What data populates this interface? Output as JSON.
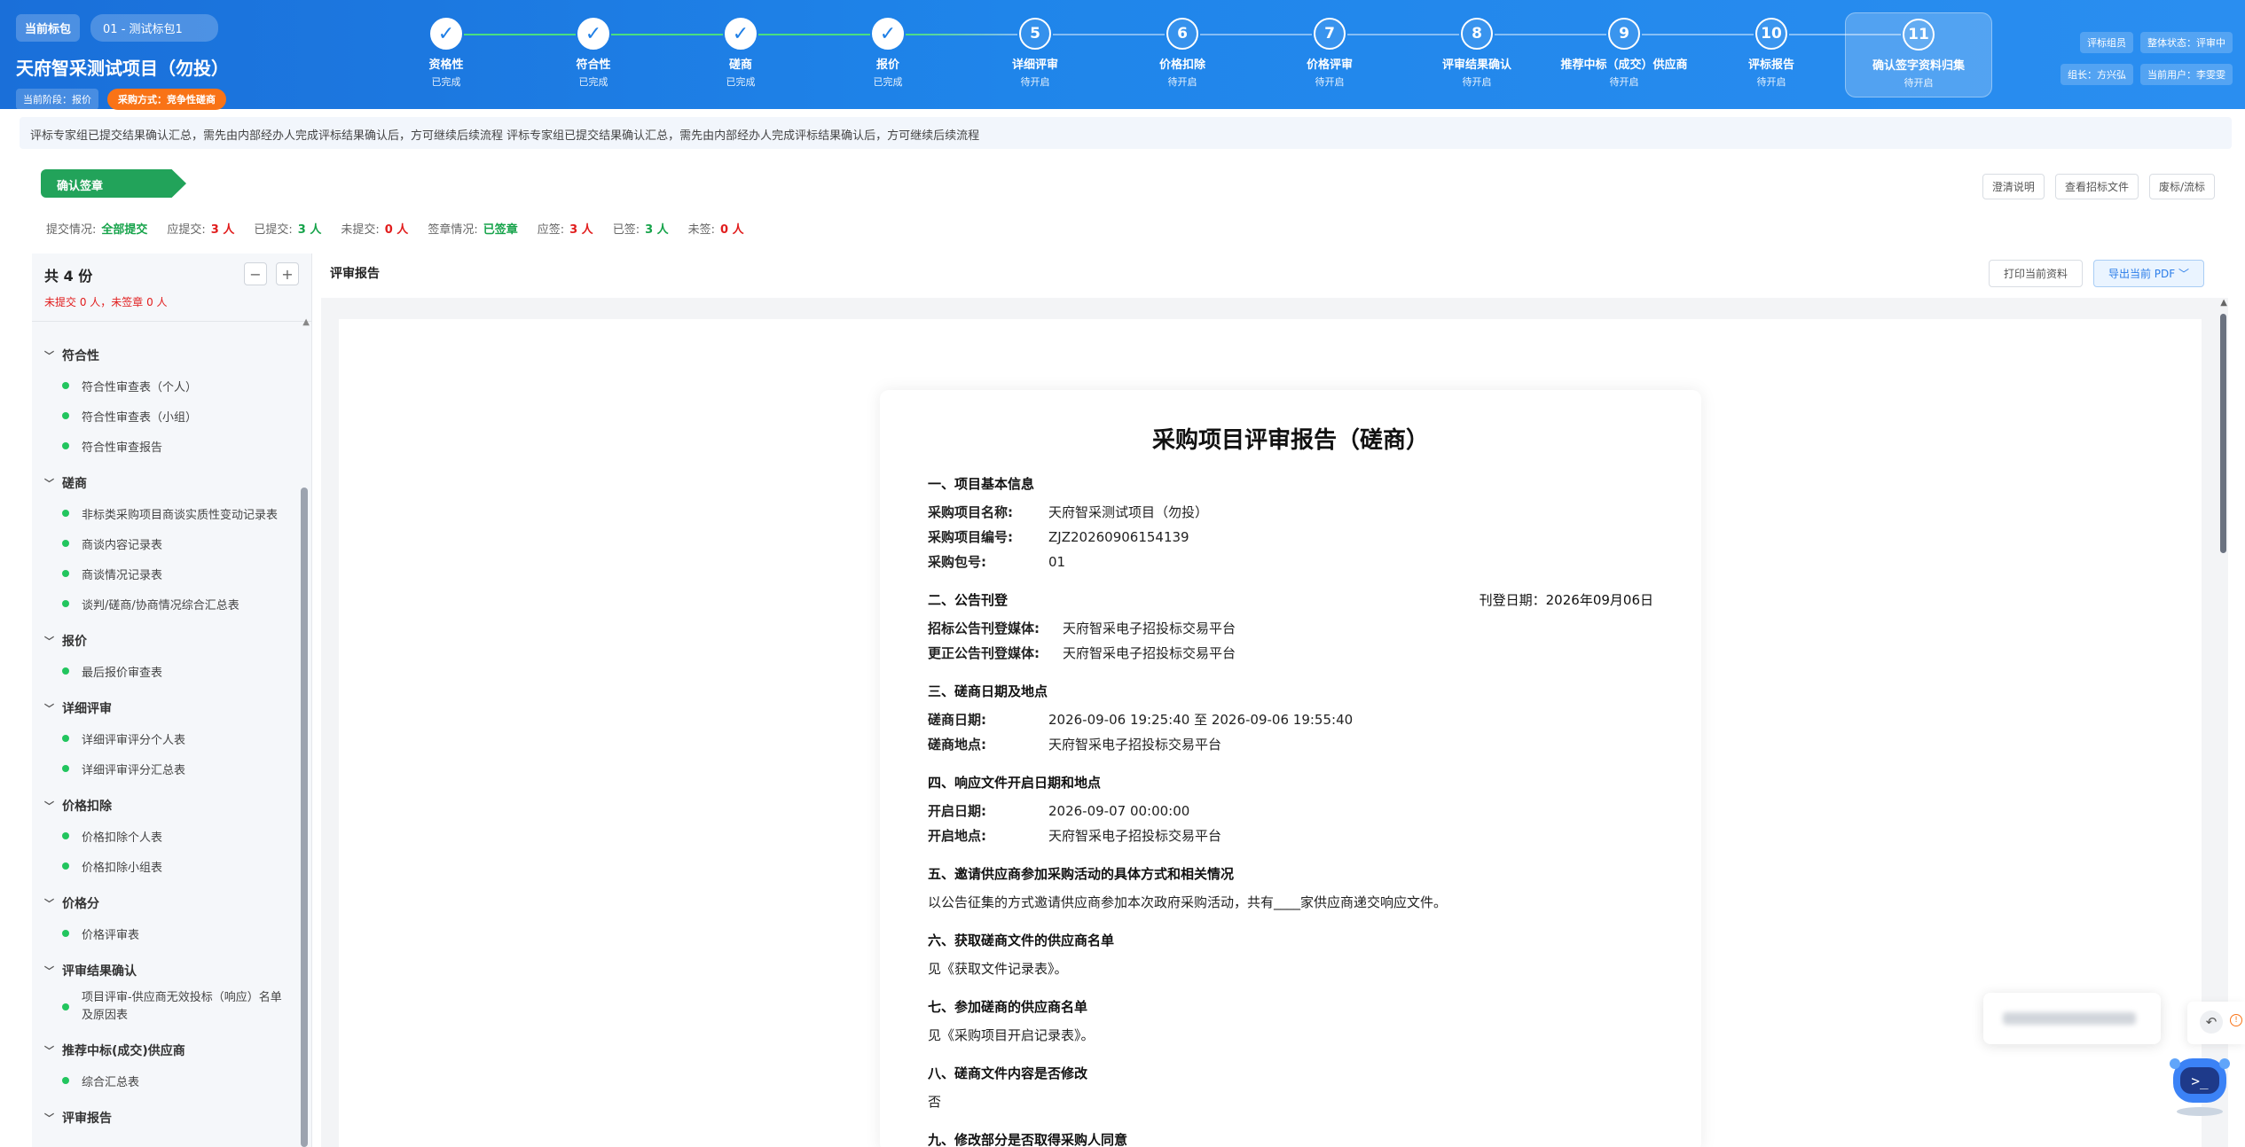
{
  "header": {
    "current_package_label": "当前标包",
    "current_package_value": "01 - 测试标包1",
    "project_title": "天府智采测试项目（勿投）",
    "stage_label": "当前阶段：报价",
    "method_label": "采购方式：竞争性磋商",
    "steps": [
      {
        "num": "1",
        "name": "资格性",
        "status": "已完成",
        "done": true
      },
      {
        "num": "2",
        "name": "符合性",
        "status": "已完成",
        "done": true
      },
      {
        "num": "3",
        "name": "磋商",
        "status": "已完成",
        "done": true
      },
      {
        "num": "4",
        "name": "报价",
        "status": "已完成",
        "done": true
      },
      {
        "num": "5",
        "name": "详细评审",
        "status": "待开启",
        "done": false
      },
      {
        "num": "6",
        "name": "价格扣除",
        "status": "待开启",
        "done": false
      },
      {
        "num": "7",
        "name": "价格评审",
        "status": "待开启",
        "done": false
      },
      {
        "num": "8",
        "name": "评审结果确认",
        "status": "待开启",
        "done": false
      },
      {
        "num": "9",
        "name": "推荐中标（成交）供应商",
        "status": "待开启",
        "done": false
      },
      {
        "num": "10",
        "name": "评标报告",
        "status": "待开启",
        "done": false
      },
      {
        "num": "11",
        "name": "确认签字资料归集",
        "status": "待开启",
        "done": false,
        "active": true
      }
    ],
    "right": {
      "role": "评标组员",
      "overall_status": "整体状态：评审中",
      "leader": "组长：方兴弘",
      "current_user": "当前用户：李雯雯"
    }
  },
  "notice": "评标专家组已提交结果确认汇总，需先由内部经办人完成评标结果确认后，方可继续后续流程 评标专家组已提交结果确认汇总，需先由内部经办人完成评标结果确认后，方可继续后续流程",
  "section": {
    "ribbon": "确认签章",
    "actions": [
      "澄清说明",
      "查看招标文件",
      "废标/流标"
    ]
  },
  "stats": {
    "submit_label": "提交情况:",
    "submit_value": "全部提交",
    "should_submit_label": "应提交:",
    "should_submit_value": "3 人",
    "submitted_label": "已提交:",
    "submitted_value": "3 人",
    "not_submitted_label": "未提交:",
    "not_submitted_value": "0 人",
    "sign_label": "签章情况:",
    "sign_value": "已签章",
    "should_sign_label": "应签:",
    "should_sign_value": "3 人",
    "signed_label": "已签:",
    "signed_value": "3 人",
    "unsigned_label": "未签:",
    "unsigned_value": "0 人"
  },
  "left_panel": {
    "count": "共 4 份",
    "sub": "未提交 0 人，未签章 0 人",
    "minus": "−",
    "plus": "+",
    "groups": [
      {
        "name": "符合性",
        "items": [
          "符合性审查表（个人）",
          "符合性审查表（小组）",
          "符合性审查报告"
        ]
      },
      {
        "name": "磋商",
        "items": [
          "非标类采购项目商谈实质性变动记录表",
          "商谈内容记录表",
          "商谈情况记录表",
          "谈判/磋商/协商情况综合汇总表"
        ]
      },
      {
        "name": "报价",
        "items": [
          "最后报价审查表"
        ]
      },
      {
        "name": "详细评审",
        "items": [
          "详细评审评分个人表",
          "详细评审评分汇总表"
        ]
      },
      {
        "name": "价格扣除",
        "items": [
          "价格扣除个人表",
          "价格扣除小组表"
        ]
      },
      {
        "name": "价格分",
        "items": [
          "价格评审表"
        ]
      },
      {
        "name": "评审结果确认",
        "items": [
          "项目评审-供应商无效投标（响应）名单及原因表"
        ]
      },
      {
        "name": "推荐中标(成交)供应商",
        "items": [
          "综合汇总表"
        ]
      },
      {
        "name": "评审报告",
        "items": []
      }
    ]
  },
  "right_panel": {
    "title": "评审报告",
    "print_label": "打印当前资料",
    "export_label": "导出当前 PDF ﹀"
  },
  "document": {
    "title": "采购项目评审报告（磋商）",
    "s1": "一、项目基本信息",
    "project_name_k": "采购项目名称:",
    "project_name_v": "天府智采测试项目（勿投）",
    "project_no_k": "采购项目编号:",
    "project_no_v": "ZJZ20260906154139",
    "package_k": "采购包号:",
    "package_v": "01",
    "s2": "二、公告刊登",
    "publish_date": "刊登日期：2026年09月06日",
    "media_k": "招标公告刊登媒体:",
    "media_v": "天府智采电子招投标交易平台",
    "correction_k": "更正公告刊登媒体:",
    "correction_v": "天府智采电子招投标交易平台",
    "s3": "三、磋商日期及地点",
    "nego_date_k": "磋商日期:",
    "nego_date_v": "2026-09-06 19:25:40 至 2026-09-06 19:55:40",
    "nego_place_k": "磋商地点:",
    "nego_place_v": "天府智采电子招投标交易平台",
    "s4": "四、响应文件开启日期和地点",
    "open_date_k": "开启日期:",
    "open_date_v": "2026-09-07 00:00:00",
    "open_place_k": "开启地点:",
    "open_place_v": "天府智采电子招投标交易平台",
    "s5": "五、邀请供应商参加采购活动的具体方式和相关情况",
    "p5": "以公告征集的方式邀请供应商参加本次政府采购活动，共有____家供应商递交响应文件。",
    "s6": "六、获取磋商文件的供应商名单",
    "p6": "见《获取文件记录表》。",
    "s7": "七、参加磋商的供应商名单",
    "p7": "见《采购项目开启记录表》。",
    "s8": "八、磋商文件内容是否修改",
    "p8": "否",
    "s9": "九、修改部分是否取得采购人同意"
  },
  "colors": {
    "header_blue": "#1f7fe6",
    "success_green": "#22a35a",
    "danger_red": "#e11d1d",
    "method_orange": "#f97316"
  }
}
